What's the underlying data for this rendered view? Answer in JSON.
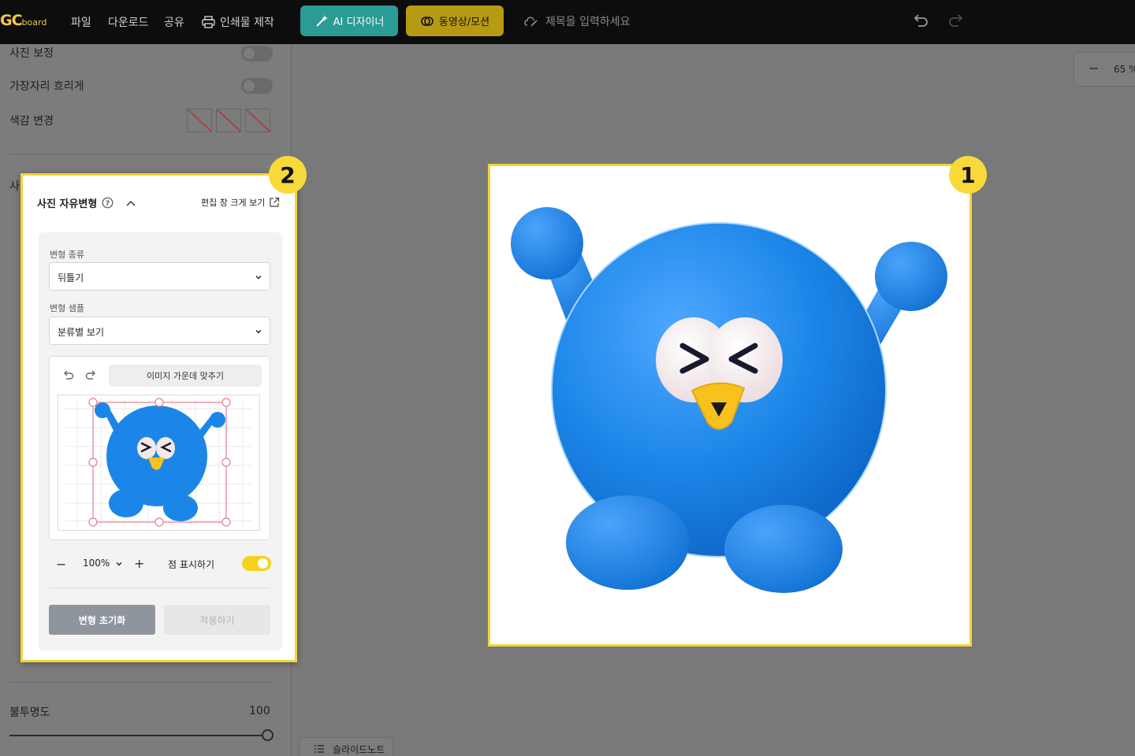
{
  "topbar": {
    "logo_main": "GC",
    "logo_sub": "board",
    "menu": [
      "파일",
      "다운로드",
      "공유",
      "인쇄물 제작"
    ],
    "ai_button": "AI 디자이너",
    "video_button": "동영상/모션",
    "title_placeholder": "제목을 입력하세요"
  },
  "sidebar": {
    "photo_correction": "사진 보정",
    "edge_blur": "가장자리 흐리게",
    "color_change": "색감 변경",
    "partial_label": "사",
    "opacity_label": "불투명도",
    "opacity_value": "100",
    "opacity_fraction": 1.0
  },
  "panel": {
    "title": "사진 자유변형",
    "expand_link": "편집 창 크게 보기",
    "type_label": "변형 종류",
    "type_value": "뒤틀기",
    "sample_label": "변형 샘플",
    "sample_value": "분류별 보기",
    "center_button": "이미지 가운데 맞추기",
    "zoom_value": "100%",
    "show_points_label": "점 표시하기",
    "show_points_on": true,
    "reset_button": "변형 초기화",
    "apply_button": "적용하기"
  },
  "canvas_zoom": "65 %",
  "badges": {
    "canvas": "1",
    "panel": "2"
  },
  "bottom_tab": "슬라이드노트",
  "colors": {
    "accent_yellow": "#f8d93a",
    "ai_teal": "#2a9b95",
    "video_gold": "#b79a13",
    "character_blue": "#1b86e8",
    "reset_gray": "#8e959d"
  }
}
